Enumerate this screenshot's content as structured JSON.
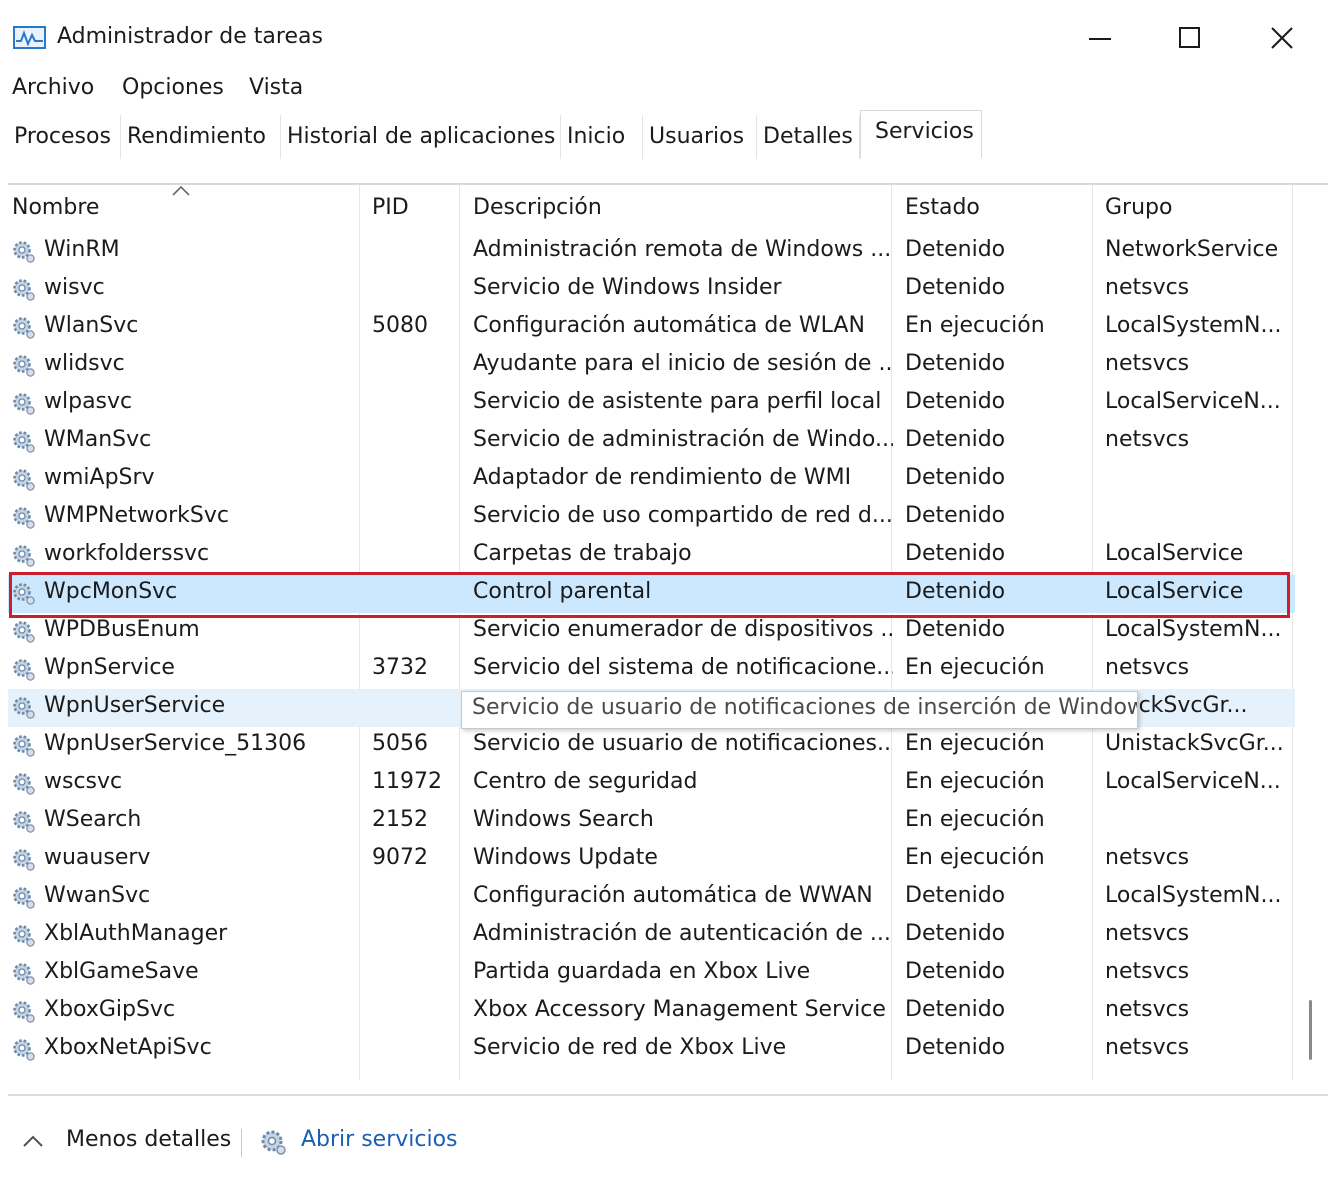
{
  "window": {
    "title": "Administrador de tareas",
    "icon": "task-manager-icon"
  },
  "menu": {
    "items": [
      "Archivo",
      "Opciones",
      "Vista"
    ]
  },
  "tabs": [
    "Procesos",
    "Rendimiento",
    "Historial de aplicaciones",
    "Inicio",
    "Usuarios",
    "Detalles",
    "Servicios"
  ],
  "active_tab": "Servicios",
  "columns": {
    "name": "Nombre",
    "pid": "PID",
    "description": "Descripción",
    "status": "Estado",
    "group": "Grupo"
  },
  "sort": {
    "column": "Nombre",
    "direction": "ascending"
  },
  "rows": [
    {
      "name": "WinRM",
      "pid": "",
      "description": "Administración remota de Windows ...",
      "status": "Detenido",
      "group": "NetworkService"
    },
    {
      "name": "wisvc",
      "pid": "",
      "description": "Servicio de Windows Insider",
      "status": "Detenido",
      "group": "netsvcs"
    },
    {
      "name": "WlanSvc",
      "pid": "5080",
      "description": "Configuración automática de WLAN",
      "status": "En ejecución",
      "group": "LocalSystemN..."
    },
    {
      "name": "wlidsvc",
      "pid": "",
      "description": "Ayudante para el inicio de sesión de ...",
      "status": "Detenido",
      "group": "netsvcs"
    },
    {
      "name": "wlpasvc",
      "pid": "",
      "description": "Servicio de asistente para perfil local",
      "status": "Detenido",
      "group": "LocalServiceN..."
    },
    {
      "name": "WManSvc",
      "pid": "",
      "description": "Servicio de administración de Windo...",
      "status": "Detenido",
      "group": "netsvcs"
    },
    {
      "name": "wmiApSrv",
      "pid": "",
      "description": "Adaptador de rendimiento de WMI",
      "status": "Detenido",
      "group": ""
    },
    {
      "name": "WMPNetworkSvc",
      "pid": "",
      "description": "Servicio de uso compartido de red d...",
      "status": "Detenido",
      "group": ""
    },
    {
      "name": "workfolderssvc",
      "pid": "",
      "description": "Carpetas de trabajo",
      "status": "Detenido",
      "group": "LocalService"
    },
    {
      "name": "WpcMonSvc",
      "pid": "",
      "description": "Control parental",
      "status": "Detenido",
      "group": "LocalService"
    },
    {
      "name": "WPDBusEnum",
      "pid": "",
      "description": "Servicio enumerador de dispositivos ...",
      "status": "Detenido",
      "group": "LocalSystemN..."
    },
    {
      "name": "WpnService",
      "pid": "3732",
      "description": "Servicio del sistema de notificacione...",
      "status": "En ejecución",
      "group": "netsvcs"
    },
    {
      "name": "WpnUserService",
      "pid": "",
      "description": "",
      "status": "",
      "group": "stackSvcGr..."
    },
    {
      "name": "WpnUserService_51306",
      "pid": "5056",
      "description": "Servicio de usuario de notificaciones...",
      "status": "En ejecución",
      "group": "UnistackSvcGr..."
    },
    {
      "name": "wscsvc",
      "pid": "11972",
      "description": "Centro de seguridad",
      "status": "En ejecución",
      "group": "LocalServiceN..."
    },
    {
      "name": "WSearch",
      "pid": "2152",
      "description": "Windows Search",
      "status": "En ejecución",
      "group": ""
    },
    {
      "name": "wuauserv",
      "pid": "9072",
      "description": "Windows Update",
      "status": "En ejecución",
      "group": "netsvcs"
    },
    {
      "name": "WwanSvc",
      "pid": "",
      "description": "Configuración automática de WWAN",
      "status": "Detenido",
      "group": "LocalSystemN..."
    },
    {
      "name": "XblAuthManager",
      "pid": "",
      "description": "Administración de autenticación de ...",
      "status": "Detenido",
      "group": "netsvcs"
    },
    {
      "name": "XblGameSave",
      "pid": "",
      "description": "Partida guardada en Xbox Live",
      "status": "Detenido",
      "group": "netsvcs"
    },
    {
      "name": "XboxGipSvc",
      "pid": "",
      "description": "Xbox Accessory Management Service",
      "status": "Detenido",
      "group": "netsvcs"
    },
    {
      "name": "XboxNetApiSvc",
      "pid": "",
      "description": "Servicio de red de Xbox Live",
      "status": "Detenido",
      "group": "netsvcs"
    }
  ],
  "selected_row": "WpcMonSvc",
  "hovered_row": "WpnUserService",
  "tooltip": {
    "text": "Servicio de usuario de notificaciones de inserción de Windows"
  },
  "footer": {
    "less_details": "Menos detalles",
    "open_services": "Abrir servicios"
  },
  "icons": {
    "service": "gear-icon",
    "minimize": "minimize-icon",
    "maximize": "maximize-icon",
    "close": "close-icon",
    "collapse": "chevron-up-icon"
  },
  "colors": {
    "selection": "#cce8ff",
    "hover": "#e5f1fb",
    "highlight_box": "#c8202f",
    "link": "#1a5fb4"
  }
}
